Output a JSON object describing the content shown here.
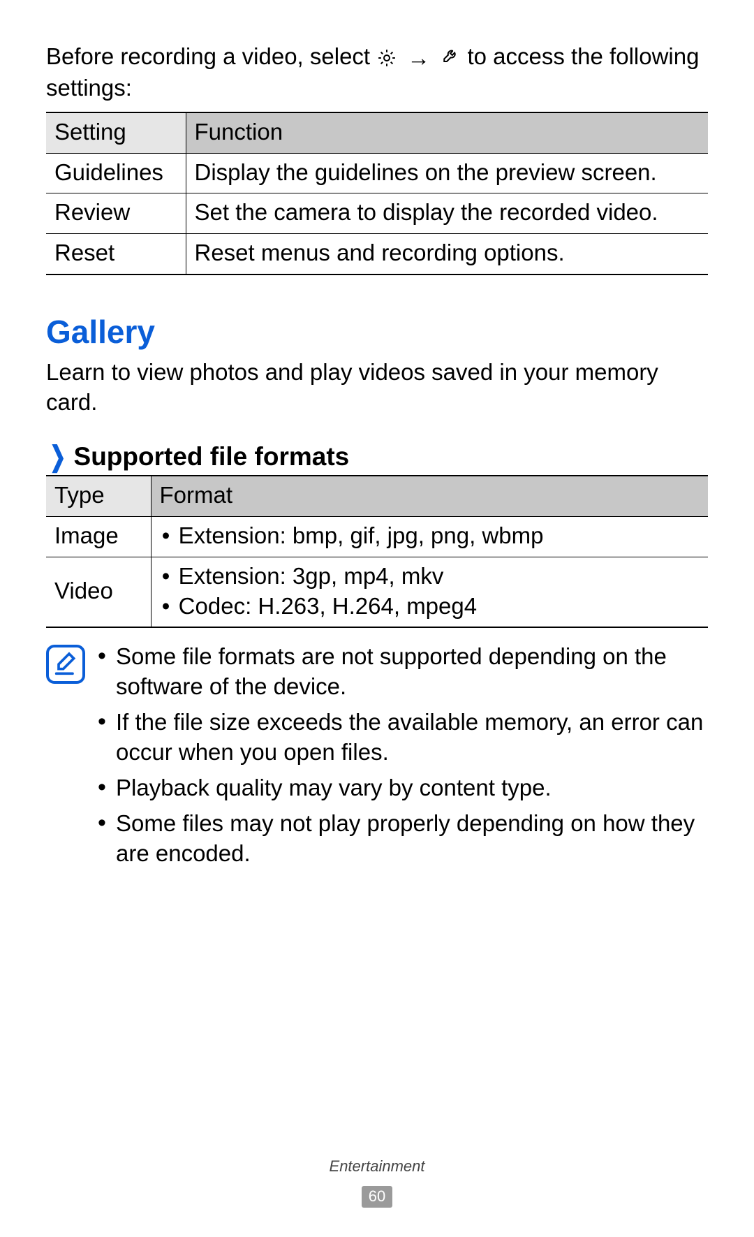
{
  "intro": {
    "before": "Before recording a video, select ",
    "arrow": "→",
    "after": " to access the following settings:",
    "gear_icon": "gear-icon",
    "wrench_icon": "wrench-icon"
  },
  "settings_table": {
    "headers": [
      "Setting",
      "Function"
    ],
    "rows": [
      {
        "setting": "Guidelines",
        "function": "Display the guidelines on the preview screen."
      },
      {
        "setting": "Review",
        "function": "Set the camera to display the recorded video."
      },
      {
        "setting": "Reset",
        "function": "Reset menus and recording options."
      }
    ]
  },
  "gallery": {
    "heading": "Gallery",
    "text": "Learn to view photos and play videos saved in your memory card."
  },
  "supported": {
    "marker": "❯",
    "heading": "Supported file formats"
  },
  "formats_table": {
    "headers": [
      "Type",
      "Format"
    ],
    "rows": [
      {
        "type": "Image",
        "lines": [
          "Extension: bmp, gif, jpg, png, wbmp"
        ]
      },
      {
        "type": "Video",
        "lines": [
          "Extension: 3gp, mp4, mkv",
          "Codec: H.263, H.264, mpeg4"
        ]
      }
    ]
  },
  "notes": [
    "Some file formats are not supported depending on the software of the device.",
    "If the file size exceeds the available memory, an error can occur when you open files.",
    "Playback quality may vary by content type.",
    "Some files may not play properly depending on how they are encoded."
  ],
  "footer": {
    "section": "Entertainment",
    "page": "60"
  }
}
